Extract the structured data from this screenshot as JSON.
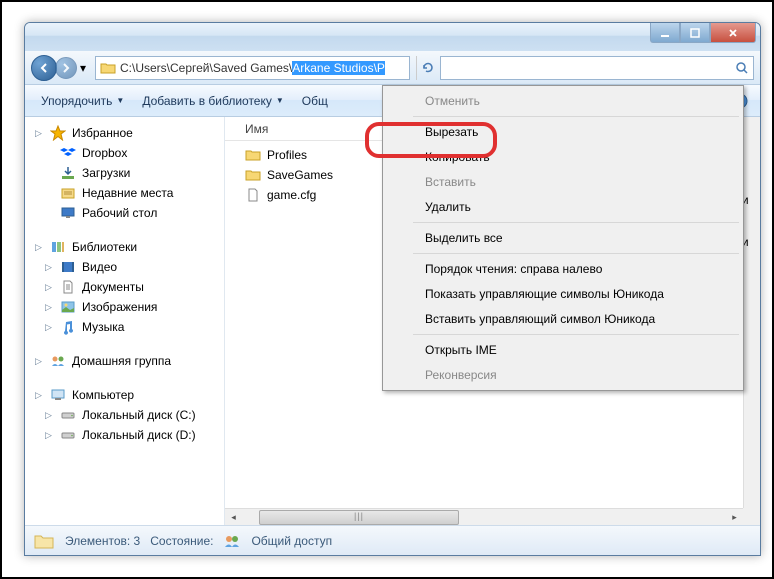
{
  "address": {
    "prefix": "C:\\Users\\Сергей\\Saved Games\\",
    "selected": "Arkane Studios\\P"
  },
  "toolbar": {
    "organize": "Упорядочить",
    "add_to_library": "Добавить в библиотеку",
    "share": "Общ"
  },
  "sidebar": {
    "favorites": {
      "header": "Избранное",
      "items": [
        "Dropbox",
        "Загрузки",
        "Недавние места",
        "Рабочий стол"
      ]
    },
    "libraries": {
      "header": "Библиотеки",
      "items": [
        "Видео",
        "Документы",
        "Изображения",
        "Музыка"
      ]
    },
    "homegroup": {
      "header": "Домашняя группа"
    },
    "computer": {
      "header": "Компьютер",
      "items": [
        "Локальный диск (C:)",
        "Локальный диск (D:)"
      ]
    }
  },
  "columns": {
    "name": "Имя"
  },
  "files": [
    {
      "name": "Profiles",
      "type": "folder"
    },
    {
      "name": "SaveGames",
      "type": "folder"
    },
    {
      "name": "game.cfg",
      "type": "file"
    }
  ],
  "context_menu": {
    "undo": "Отменить",
    "cut": "Вырезать",
    "copy": "Копировать",
    "paste": "Вставить",
    "delete": "Удалить",
    "select_all": "Выделить все",
    "reading_order": "Порядок чтения: справа налево",
    "show_unicode": "Показать управляющие символы Юникода",
    "insert_unicode": "Вставить управляющий символ Юникода",
    "open_ime": "Открыть IME",
    "reconversion": "Реконверсия"
  },
  "right_panel_text": {
    "line1": "лами",
    "line2": "лами"
  },
  "statusbar": {
    "elements_label": "Элементов:",
    "elements_count": "3",
    "state_label": "Состояние:",
    "shared": "Общий доступ"
  }
}
